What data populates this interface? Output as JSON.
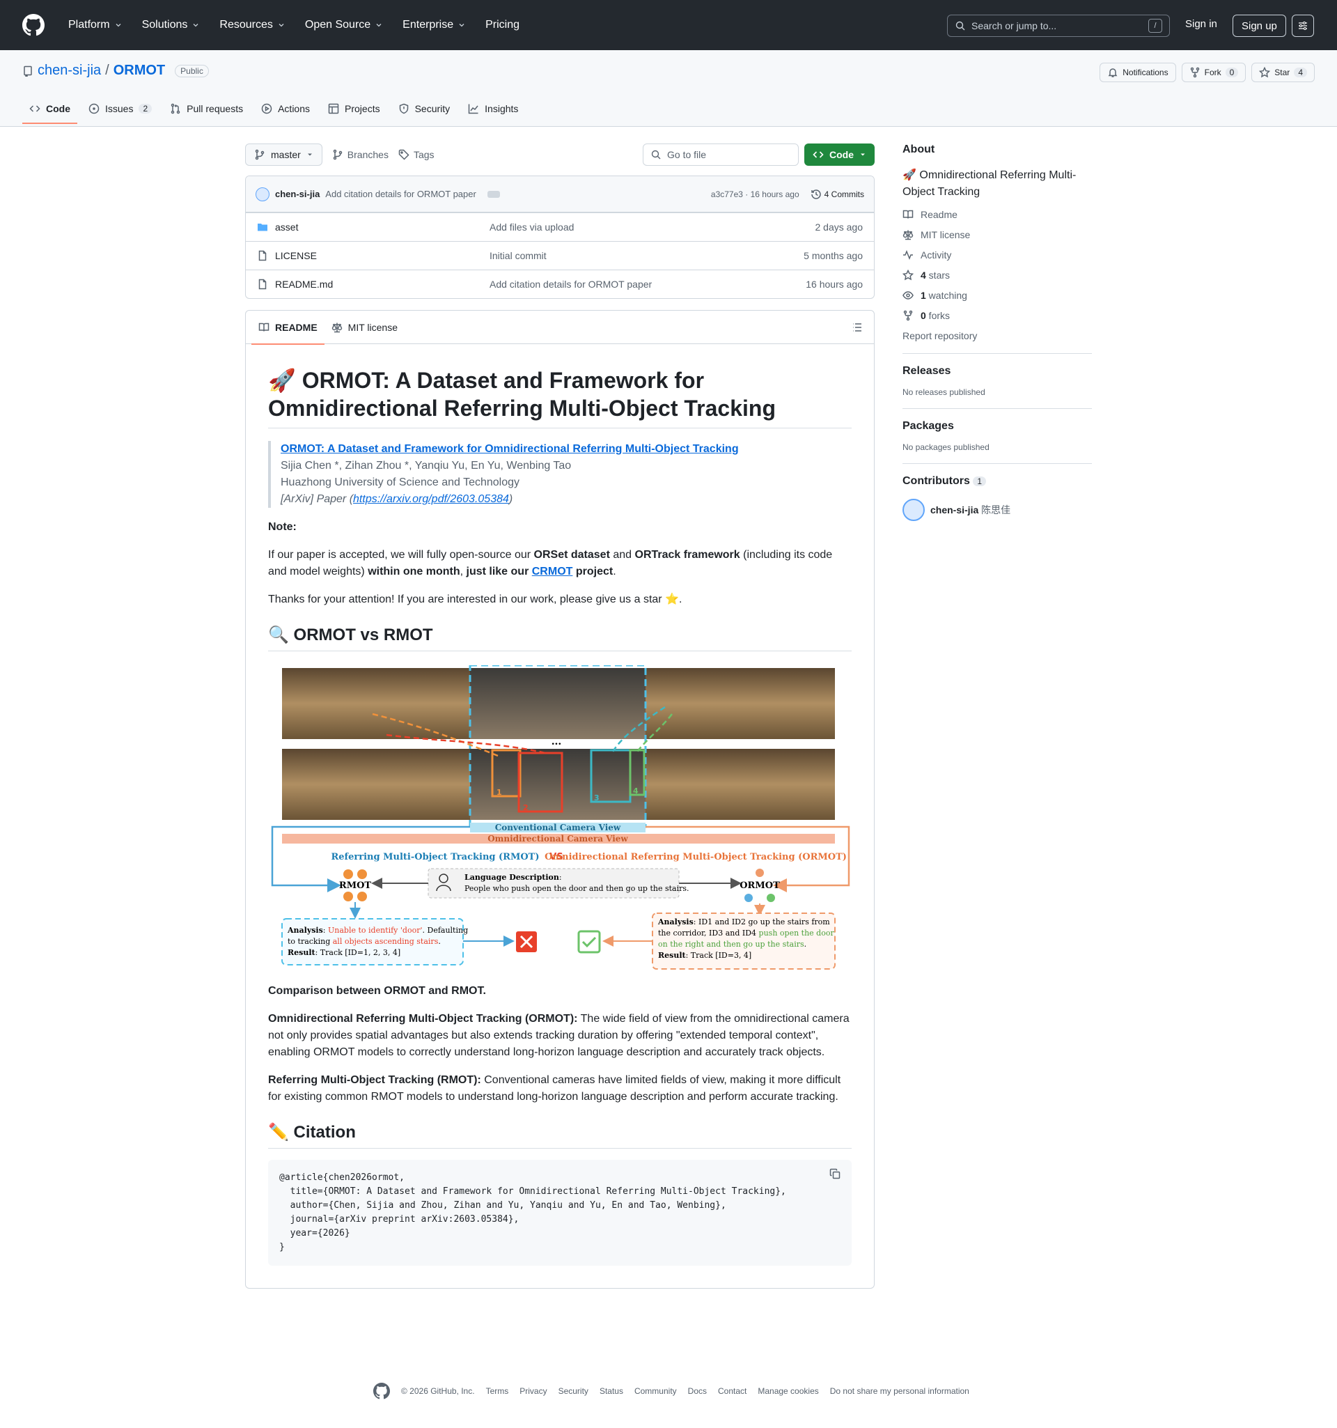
{
  "header": {
    "nav": [
      "Platform",
      "Solutions",
      "Resources",
      "Open Source",
      "Enterprise",
      "Pricing"
    ],
    "search_placeholder": "Search or jump to...",
    "search_kbd": "/",
    "sign_in": "Sign in",
    "sign_up": "Sign up"
  },
  "repo": {
    "owner": "chen-si-jia",
    "sep": "/",
    "name": "ORMOT",
    "visibility": "Public",
    "notifications": "Notifications",
    "fork_label": "Fork",
    "fork_count": "0",
    "star_label": "Star",
    "star_count": "4",
    "tabs": [
      "Code",
      "Issues",
      "Pull requests",
      "Actions",
      "Projects",
      "Security",
      "Insights"
    ],
    "issues_count": "2"
  },
  "toolbar": {
    "branch": "master",
    "branches": "Branches",
    "tags": "Tags",
    "goto_placeholder": "Go to file",
    "code_button": "Code"
  },
  "commit": {
    "author": "chen-si-jia",
    "message": "Add citation details for ORMOT paper",
    "hash_time": "a3c77e3 · 16 hours ago",
    "count": "4 Commits"
  },
  "files": [
    {
      "name": "asset",
      "type": "folder",
      "message": "Add files via upload",
      "date": "2 days ago"
    },
    {
      "name": "LICENSE",
      "type": "file",
      "message": "Initial commit",
      "date": "5 months ago"
    },
    {
      "name": "README.md",
      "type": "file",
      "message": "Add citation details for ORMOT paper",
      "date": "16 hours ago"
    }
  ],
  "readme_tabs": [
    "README",
    "MIT license"
  ],
  "readme": {
    "title": "🚀 ORMOT: A Dataset and Framework for Omnidirectional Referring Multi-Object Tracking",
    "quote_link": "ORMOT: A Dataset and Framework for Omnidirectional Referring Multi-Object Tracking",
    "authors": "Sijia Chen *, Zihan Zhou *, Yanqiu Yu, En Yu, Wenbing Tao",
    "affiliation": "Huazhong University of Science and Technology",
    "paper_prefix": "[ArXiv] Paper (",
    "paper_url": "https://arxiv.org/pdf/2603.05384",
    "paper_suffix": ")",
    "note_label": "Note:",
    "note_p1": "If our paper is accepted, we will fully open-source our ",
    "note_orset": "ORSet dataset",
    "note_and": " and ",
    "note_ortrack": "ORTrack framework",
    "note_p2": " (including its code and model weights) ",
    "note_within": "within one month",
    "note_comma": ", ",
    "note_like": "just like our ",
    "note_crmot": "CRMOT",
    "note_project": " project",
    "note_end": ".",
    "thanks": "Thanks for your attention! If you are interested in our work, please give us a star ⭐.",
    "h2_compare": "🔍 ORMOT vs RMOT",
    "fig": {
      "conv_view": "Conventional Camera View",
      "omni_view": "Omnidirectional Camera View",
      "rmot_title": "Referring Multi-Object Tracking (RMOT)",
      "vs": "VS",
      "ormot_title": "Omnidirectional Referring Multi-Object Tracking (ORMOT)",
      "rmot": "RMOT",
      "ormot": "ORMOT",
      "lang_label": "Language Description",
      "lang_colon": ":",
      "lang_text": "People who push open the door and then go up the stairs.",
      "dots": "...",
      "box1": "1",
      "box2": "2",
      "box3": "3",
      "box4": "4",
      "left_analysis_label": "Analysis",
      "left_a1": ": ",
      "left_a_red": "Unable to identify 'door'",
      "left_a2": ". Defaulting",
      "left_a3": "to tracking ",
      "left_a_red2": "all objects ascending stairs",
      "left_a4": ".",
      "left_result_label": "Result",
      "left_result": ": Track [ID=1, 2, 3, 4]",
      "right_analysis_label": "Analysis",
      "right_a1": ": ID1 and ID2 go up the stairs from",
      "right_a2": "the corridor, ID3 and ID4 ",
      "right_a_green": "push open the door",
      "right_a_green2": "on the right and then go up the stairs",
      "right_a3": ".",
      "right_result_label": "Result",
      "right_result": ": Track [ID=3, 4]"
    },
    "caption": "Comparison between ORMOT and RMOT.",
    "ormot_label": "Omnidirectional Referring Multi-Object Tracking (ORMOT):",
    "ormot_text": " The wide field of view from the omnidirectional camera not only provides spatial advantages but also extends tracking duration by offering \"extended temporal context\", enabling ORMOT models to correctly understand long-horizon language description and accurately track objects.",
    "rmot_label": "Referring Multi-Object Tracking (RMOT):",
    "rmot_text": " Conventional cameras have limited fields of view, making it more difficult for existing common RMOT models to understand long-horizon language description and perform accurate tracking.",
    "h2_citation": "✏️ Citation",
    "citation": "@article{chen2026ormot,\n  title={ORMOT: A Dataset and Framework for Omnidirectional Referring Multi-Object Tracking},\n  author={Chen, Sijia and Zhou, Zihan and Yu, Yanqiu and Yu, En and Tao, Wenbing},\n  journal={arXiv preprint arXiv:2603.05384},\n  year={2026}\n}"
  },
  "sidebar": {
    "about": "About",
    "description": "🚀 Omnidirectional Referring Multi-Object Tracking",
    "readme": "Readme",
    "license": "MIT license",
    "activity": "Activity",
    "stars_num": "4",
    "stars_word": " stars",
    "watching_num": "1",
    "watching_word": " watching",
    "forks_num": "0",
    "forks_word": " forks",
    "report": "Report repository",
    "releases": "Releases",
    "no_releases": "No releases published",
    "packages": "Packages",
    "no_packages": "No packages published",
    "contributors": "Contributors",
    "contributors_count": "1",
    "contributor_login": "chen-si-jia",
    "contributor_name": " 陈思佳"
  },
  "footer": [
    "© 2026 GitHub, Inc.",
    "Terms",
    "Privacy",
    "Security",
    "Status",
    "Community",
    "Docs",
    "Contact",
    "Manage cookies",
    "Do not share my personal information"
  ],
  "colors": {
    "header": "#24292f",
    "accent": "#0969da",
    "green": "#1f883d",
    "tab_underline": "#fd8c73"
  }
}
